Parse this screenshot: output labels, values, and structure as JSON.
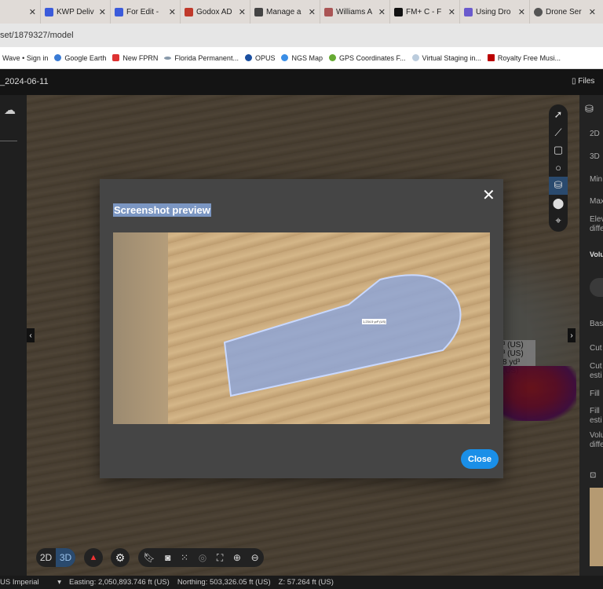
{
  "browser": {
    "tabs": [
      {
        "label": "",
        "color": "#888"
      },
      {
        "label": "KWP Deliv",
        "color": "#3b5bdb"
      },
      {
        "label": "For Edit -",
        "color": "#3b5bdb"
      },
      {
        "label": "Godox AD",
        "color": "#c0392b"
      },
      {
        "label": "Manage a",
        "color": "#444"
      },
      {
        "label": "Williams A",
        "color": "#a55"
      },
      {
        "label": "FM+ C - F",
        "color": "#111"
      },
      {
        "label": "Using Dro",
        "color": "#6a5acd"
      },
      {
        "label": "Drone Ser",
        "color": "#555"
      }
    ],
    "address": "set/1879327/model",
    "bookmarks": [
      {
        "label": "Wave • Sign in",
        "color": ""
      },
      {
        "label": "Google Earth",
        "color": "#3a7bd5"
      },
      {
        "label": "New FPRN",
        "color": "#d33"
      },
      {
        "label": "Florida Permanent...",
        "color": "#89a"
      },
      {
        "label": "OPUS",
        "color": "#1a4fa0"
      },
      {
        "label": "NGS Map",
        "color": "#3a8ee6"
      },
      {
        "label": "GPS Coordinates F...",
        "color": "#6a3"
      },
      {
        "label": "Virtual Staging in...",
        "color": "#bcd"
      },
      {
        "label": "Royalty Free Musi...",
        "color": "#b00"
      }
    ]
  },
  "app": {
    "title": "_2024-06-11",
    "files_label": "Files"
  },
  "right_panel": {
    "items": [
      "2D",
      "3D",
      "Min",
      "Max",
      "Elev",
      "diffe",
      "Volu",
      "Bas",
      "Cut",
      "Cut",
      "esti",
      "Fill",
      "Fill",
      "esti",
      "Volu",
      "diffe"
    ]
  },
  "map_labels": [
    "³ (US)",
    "³ (US)",
    "8 yd³ (US)"
  ],
  "modal": {
    "title": "Screenshot preview",
    "close_label": "Close",
    "preview_label": "1,234.5 yd³ (US)"
  },
  "toolbar": {
    "mode_2d": "2D",
    "mode_3d": "3D",
    "active_mode": "3D"
  },
  "status": {
    "units": "US Imperial",
    "easting": "Easting: 2,050,893.746 ft (US)",
    "northing": "Northing: 503,326.05 ft (US)",
    "z": "Z: 57.264 ft (US)"
  }
}
